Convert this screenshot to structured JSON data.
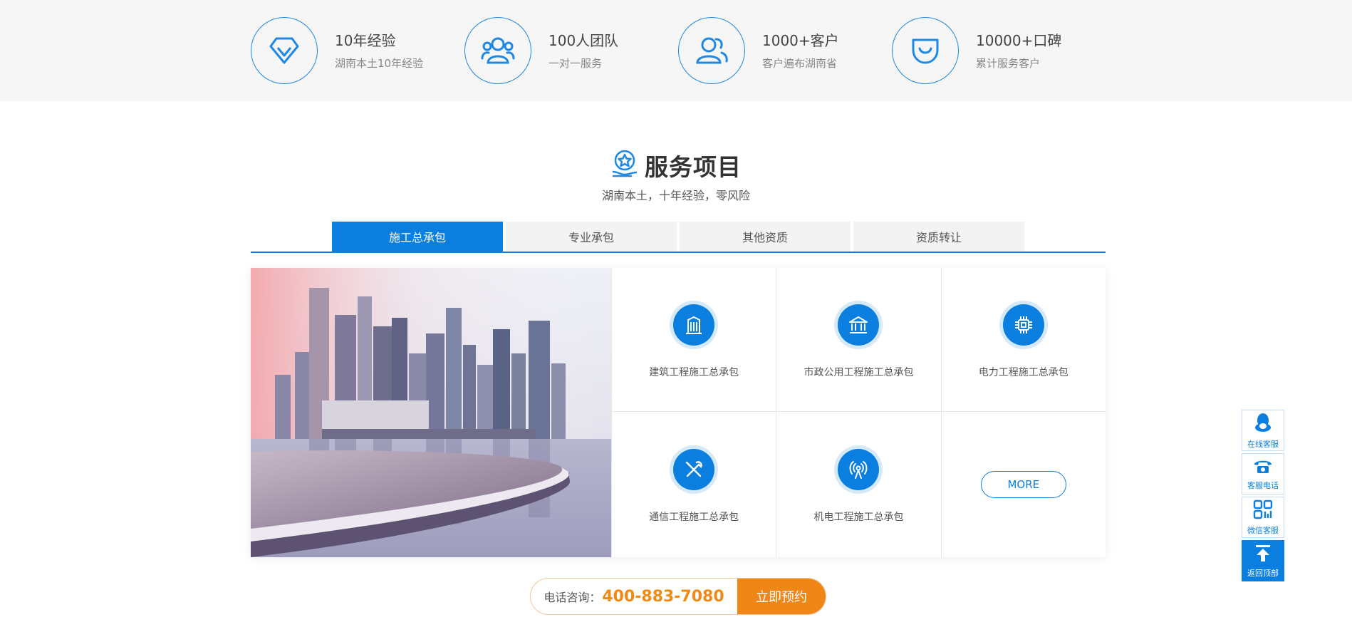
{
  "features": [
    {
      "title": "10年经验",
      "subtitle": "湖南本土10年经验",
      "icon": "diamond-icon"
    },
    {
      "title": "100人团队",
      "subtitle": "一对一服务",
      "icon": "team-icon"
    },
    {
      "title": "1000+客户",
      "subtitle": "客户遍布湖南省",
      "icon": "customers-icon"
    },
    {
      "title": "10000+口碑",
      "subtitle": "累计服务客户",
      "icon": "smile-shield-icon"
    }
  ],
  "section": {
    "title": "服务项目",
    "subtitle": "湖南本土，十年经验，零风险"
  },
  "tabs": [
    {
      "label": "施工总承包",
      "active": true
    },
    {
      "label": "专业承包",
      "active": false
    },
    {
      "label": "其他资质",
      "active": false
    },
    {
      "label": "资质转让",
      "active": false
    }
  ],
  "services": [
    {
      "label": "建筑工程施工总承包",
      "icon": "building-icon"
    },
    {
      "label": "市政公用工程施工总承包",
      "icon": "public-building-icon"
    },
    {
      "label": "电力工程施工总承包",
      "icon": "chip-icon"
    },
    {
      "label": "通信工程施工总承包",
      "icon": "tools-icon"
    },
    {
      "label": "机电工程施工总承包",
      "icon": "antenna-icon"
    }
  ],
  "more_label": "MORE",
  "call": {
    "label": "电话咨询：",
    "number": "400-883-7080",
    "button": "立即预约"
  },
  "sidebar": [
    {
      "label": "在线客服",
      "icon": "qq-penguin-icon"
    },
    {
      "label": "客服电话",
      "icon": "phone-icon"
    },
    {
      "label": "微信客服",
      "icon": "qr-code-icon"
    },
    {
      "label": "返回顶部",
      "icon": "back-to-top-icon"
    }
  ],
  "colors": {
    "accent": "#0b7fe0",
    "orange": "#ef8615"
  }
}
